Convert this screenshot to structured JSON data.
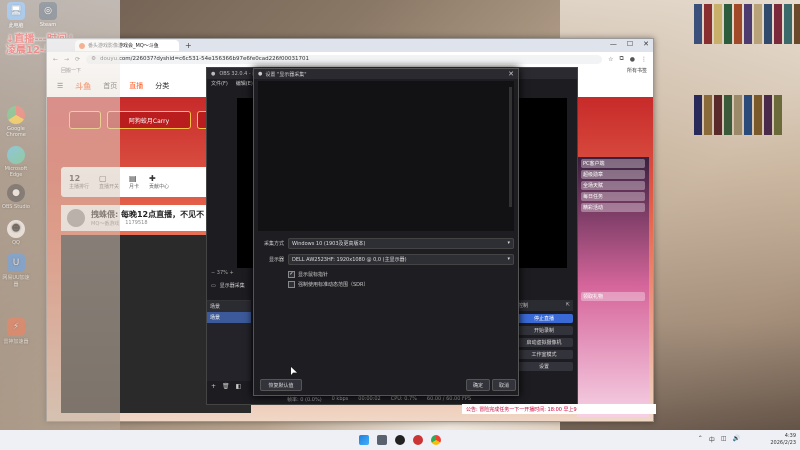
{
  "overlay": {
    "line1": "↓直播---时间↓",
    "line2": "凌晨12-早10"
  },
  "desktop_icons": [
    {
      "label": "此电脑"
    },
    {
      "label": "Steam"
    },
    {
      "label": "Google Chrome"
    },
    {
      "label": "Microsoft Edge"
    },
    {
      "label": "OBS Studio"
    },
    {
      "label": "QQ"
    },
    {
      "label": "网易UU加速器"
    },
    {
      "label": "雷神加速器"
    }
  ],
  "browser": {
    "tab_title": "番头游戏影像游戏会_MQ～斗鱼",
    "new_tab": "+",
    "url": "douyu.com/226037?dyshid=c6c531-54e156366b97e6fe0cad226f00031701",
    "bookmark_home": "回搬一下",
    "bookmark_all": "所有书签",
    "win_min": "—",
    "win_max": "☐",
    "win_close": "✕"
  },
  "site": {
    "logo": "斗鱼",
    "nav": [
      "首页",
      "直播",
      "分类"
    ],
    "streamer_btn": "阿狗蛟月Carry",
    "stats": [
      {
        "value": "12",
        "label": "主播排行"
      },
      {
        "value": "",
        "label": "直播开关"
      },
      {
        "value": "",
        "label": "月卡"
      },
      {
        "value": "",
        "label": "贡献中心"
      }
    ],
    "stream_title": "拽蛛偎: 每晚12点直播，不见不",
    "stream_meta": "MQ～番游戏",
    "viewer_count": "1179518",
    "right_items": [
      "PC客户端",
      "超级勋章",
      "全场天赋",
      "每日任务",
      "精彩活动",
      "领取礼物"
    ]
  },
  "obs": {
    "title": "OBS 32.0.4 - 配置文件: 未命名 - 场景: 未命名",
    "menu": [
      "文件(F)",
      "编辑(E)"
    ],
    "zoom": "37%",
    "source_label": "显示器采集",
    "scenes_header": "场景",
    "scene_item": "场景",
    "controls_header": "控制",
    "controls": [
      "停止直播",
      "开始录制",
      "启动虚拟摄像机",
      "工作室模式",
      "设置"
    ],
    "status": [
      "帧率: 0 (0.0%)",
      "0 kbps",
      "00:00:02",
      "CPU: 0.7%",
      "60.00 / 60.00 FPS"
    ],
    "ticker": "公告: 冒险完成任务一下一开播时间: 18:00 早上9"
  },
  "dialog": {
    "title": "设置 \"显示器采集\"",
    "close": "✕",
    "method_label": "采集方式",
    "method_value": "Windows 10 (1903及更高版本)",
    "display_label": "显示器",
    "display_value": "DELL AW2523HF: 1920x1080 @ 0,0 (主显示器)",
    "show_cursor": "显示鼠标指针",
    "show_cursor_checked": "✓",
    "sdr": "强制使用标准动态范围（SDR）",
    "defaults_btn": "恢复默认值",
    "ok_btn": "确定",
    "cancel_btn": "取消"
  },
  "taskbar": {
    "time": "4:39",
    "date": "2026/2/23",
    "lang": "中"
  }
}
